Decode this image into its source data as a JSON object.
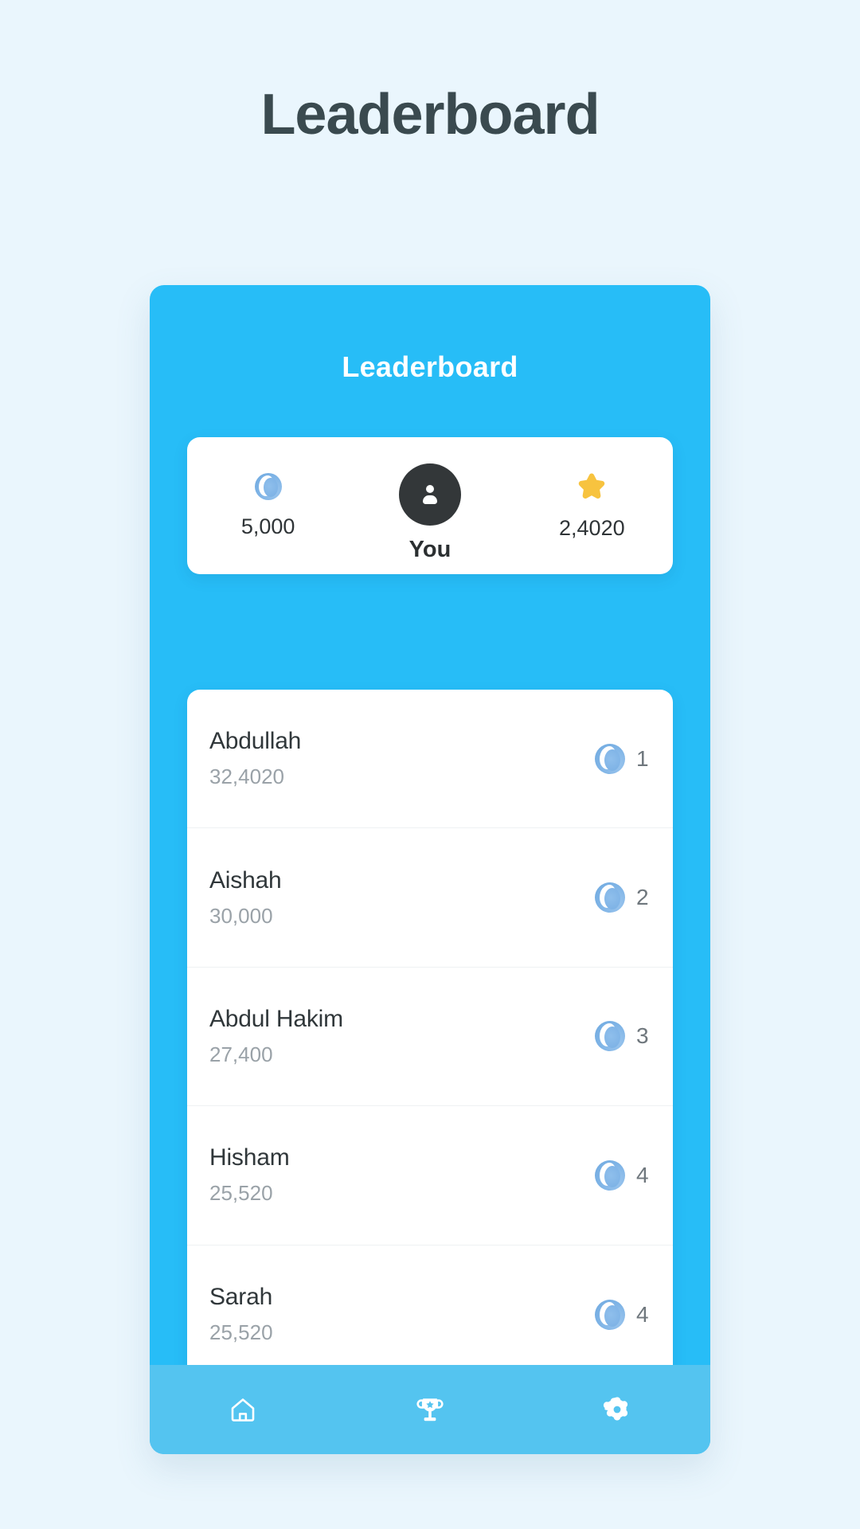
{
  "page": {
    "title": "Leaderboard",
    "background_color": "#eaf6fd",
    "title_color": "#3a4a4f"
  },
  "phone": {
    "accent_color": "#27bdf7",
    "nav_color": "#54c4f0",
    "header": {
      "title": "Leaderboard"
    },
    "you_card": {
      "left_stat": {
        "icon": "sphere-icon",
        "value": "5,000"
      },
      "center_stat": {
        "icon": "person-avatar-icon",
        "label": "You"
      },
      "right_stat": {
        "icon": "star-icon",
        "icon_color": "#f7c33f",
        "value": "2,4020"
      }
    },
    "drag_handle": {
      "icon": "drag-handle-icon"
    },
    "leaderboard": {
      "rank_icon": "sphere-icon",
      "rows": [
        {
          "name": "Abdullah",
          "score": "32,4020",
          "rank": "1"
        },
        {
          "name": "Aishah",
          "score": "30,000",
          "rank": "2"
        },
        {
          "name": "Abdul Hakim",
          "score": "27,400",
          "rank": "3"
        },
        {
          "name": "Hisham",
          "score": "25,520",
          "rank": "4"
        },
        {
          "name": "Sarah",
          "score": "25,520",
          "rank": "4"
        }
      ]
    },
    "bottom_nav": {
      "items": [
        {
          "icon": "home-icon",
          "label": "Home"
        },
        {
          "icon": "trophy-icon",
          "label": "Leaderboard"
        },
        {
          "icon": "gear-icon",
          "label": "Settings"
        }
      ],
      "active_index": 1
    }
  }
}
